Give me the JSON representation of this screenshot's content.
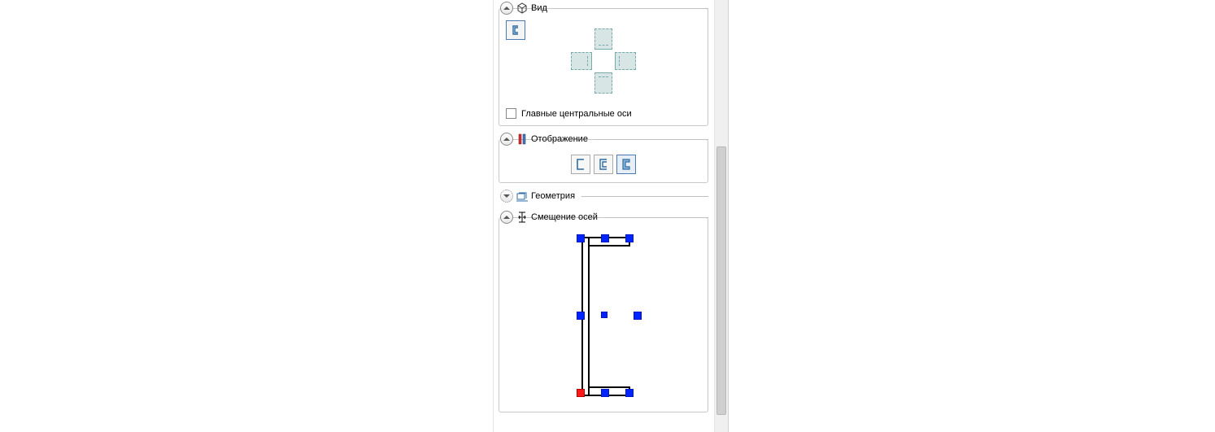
{
  "sections": {
    "view": {
      "label": "Вид",
      "checkbox_label": "Главные центральные оси",
      "checkbox_checked": false
    },
    "display": {
      "label": "Отображение"
    },
    "geometry": {
      "label": "Геометрия"
    },
    "offset": {
      "label": "Смещение осей"
    }
  },
  "display_modes": {
    "selected": 2
  },
  "offset_diagram": {
    "selected_marker": "bottom-left"
  }
}
